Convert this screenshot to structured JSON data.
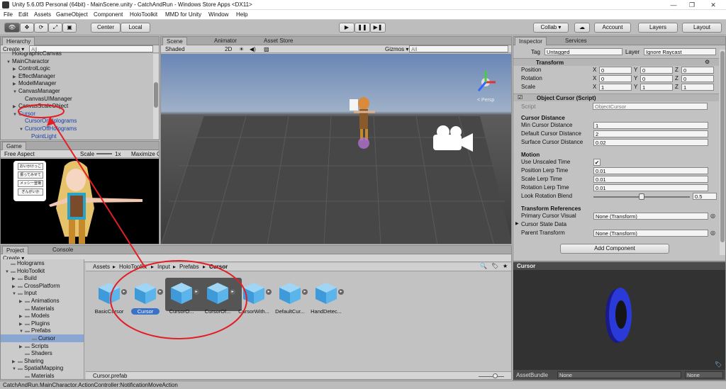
{
  "window": {
    "title": "Unity 5.6.0f3 Personal (64bit) - MainScene.unity - CatchAndRun - Windows Store Apps <DX11>",
    "min": "—",
    "max": "❐",
    "close": "✕"
  },
  "menu": [
    "File",
    "Edit",
    "Assets",
    "GameObject",
    "Component",
    "HoloToolkit",
    "MMD for Unity",
    "Window",
    "Help"
  ],
  "toolbar": {
    "center": "Center",
    "local": "Local",
    "play": "▶",
    "pause": "❚❚",
    "step": "▶❚",
    "collab": "Collab ▾",
    "cloud": "☁",
    "account": "Account",
    "layers": "Layers",
    "layout": "Layout"
  },
  "hierarchy": {
    "tab": "Hierarchy",
    "create": "Create ▾",
    "search": "All",
    "items": [
      {
        "label": "HolographicCanvas",
        "depth": 0,
        "arrow": ""
      },
      {
        "label": "MainCharactor",
        "depth": 0,
        "arrow": "▼"
      },
      {
        "label": "ControlLogic",
        "depth": 1,
        "arrow": "▶"
      },
      {
        "label": "EffectManager",
        "depth": 1,
        "arrow": "▶"
      },
      {
        "label": "ModelManager",
        "depth": 1,
        "arrow": "▶"
      },
      {
        "label": "CanvasManager",
        "depth": 1,
        "arrow": "▼"
      },
      {
        "label": "CanvasUIManager",
        "depth": 2,
        "arrow": ""
      },
      {
        "label": "CanvasScaleObject",
        "depth": 1,
        "arrow": "▶"
      },
      {
        "label": "Cursor",
        "depth": 1,
        "arrow": "▼"
      },
      {
        "label": "CursorOnHolograms",
        "depth": 2,
        "arrow": ""
      },
      {
        "label": "CursorOffHolograms",
        "depth": 2,
        "arrow": "▼"
      },
      {
        "label": "PointLight",
        "depth": 3,
        "arrow": ""
      }
    ]
  },
  "game": {
    "tab": "Game",
    "aspect": "Free Aspect",
    "scale": "Scale",
    "scale_val": "1x",
    "maximize": "Maximize O",
    "buttons": [
      "おいかけっこ",
      "振ってみせて",
      "メッシー登場",
      "ぎんがいか"
    ]
  },
  "scene": {
    "tabs": [
      "Scene",
      "Animator",
      "Asset Store"
    ],
    "shaded": "Shaded",
    "mode2d": "2D",
    "gizmos": "Gizmos ▾",
    "search": "All",
    "persp": "< Persp"
  },
  "inspector": {
    "tabs": [
      "Inspector",
      "Services"
    ],
    "tag_label": "Tag",
    "tag": "Untagged",
    "layer_label": "Layer",
    "layer": "Ignore Raycast",
    "transform": {
      "title": "Transform",
      "rows": [
        {
          "label": "Position",
          "x": "0",
          "y": "0",
          "z": "0"
        },
        {
          "label": "Rotation",
          "x": "0",
          "y": "0",
          "z": "0"
        },
        {
          "label": "Scale",
          "x": "1",
          "y": "1",
          "z": "1"
        }
      ]
    },
    "script_comp": {
      "title": "Object Cursor (Script)",
      "script_label": "Script",
      "script": "ObjectCursor"
    },
    "sections": [
      {
        "header": "Cursor Distance",
        "rows": [
          {
            "label": "Min Cursor Distance",
            "value": "1"
          },
          {
            "label": "Default Cursor Distance",
            "value": "2"
          },
          {
            "label": "Surface Cursor Distance",
            "value": "0.02"
          }
        ]
      },
      {
        "header": "Motion",
        "rows": [
          {
            "label": "Use Unscaled Time",
            "value": "✔"
          },
          {
            "label": "Position Lerp Time",
            "value": "0.01"
          },
          {
            "label": "Scale Lerp Time",
            "value": "0.01"
          },
          {
            "label": "Rotation Lerp Time",
            "value": "0.01"
          },
          {
            "label": "Look Rotation Blend",
            "value": "0.5"
          }
        ]
      },
      {
        "header": "Transform References",
        "rows": [
          {
            "label": "Primary Cursor Visual",
            "value": "None (Transform)"
          },
          {
            "label": "Cursor State Data",
            "value": ""
          },
          {
            "label": "Parent Transform",
            "value": "None (Transform)"
          }
        ]
      }
    ],
    "add_component": "Add Component"
  },
  "preview": {
    "title": "Cursor",
    "assetbundle": "AssetBundle",
    "none1": "None",
    "none2": "None"
  },
  "project": {
    "tabs": [
      "Project",
      "Console"
    ],
    "create": "Create ▾",
    "tree": [
      {
        "label": "Holograms",
        "depth": 0,
        "arrow": ""
      },
      {
        "label": "HoloToolkit",
        "depth": 0,
        "arrow": "▼"
      },
      {
        "label": "Build",
        "depth": 1,
        "arrow": "▶"
      },
      {
        "label": "CrossPlatform",
        "depth": 1,
        "arrow": "▶"
      },
      {
        "label": "Input",
        "depth": 1,
        "arrow": "▼"
      },
      {
        "label": "Animations",
        "depth": 2,
        "arrow": "▶"
      },
      {
        "label": "Materials",
        "depth": 2,
        "arrow": ""
      },
      {
        "label": "Models",
        "depth": 2,
        "arrow": "▶"
      },
      {
        "label": "Plugins",
        "depth": 2,
        "arrow": "▶"
      },
      {
        "label": "Prefabs",
        "depth": 2,
        "arrow": "▼"
      },
      {
        "label": "Cursor",
        "depth": 3,
        "arrow": ""
      },
      {
        "label": "Scripts",
        "depth": 2,
        "arrow": "▶"
      },
      {
        "label": "Shaders",
        "depth": 2,
        "arrow": ""
      },
      {
        "label": "Sharing",
        "depth": 1,
        "arrow": "▶"
      },
      {
        "label": "SpatialMapping",
        "depth": 1,
        "arrow": "▼"
      },
      {
        "label": "Materials",
        "depth": 2,
        "arrow": ""
      }
    ],
    "breadcrumb": [
      "Assets",
      "HoloToolkit",
      "Input",
      "Prefabs",
      "Cursor"
    ],
    "assets": [
      "BasicCursor",
      "Cursor",
      "CursorO...",
      "CursorOf...",
      "CursorWith...",
      "DefaultCur...",
      "HandDetec..."
    ],
    "selected_file": "Cursor.prefab"
  },
  "status": "CatchAndRun.MainCharactor.ActionController:NotificationMoveAction"
}
